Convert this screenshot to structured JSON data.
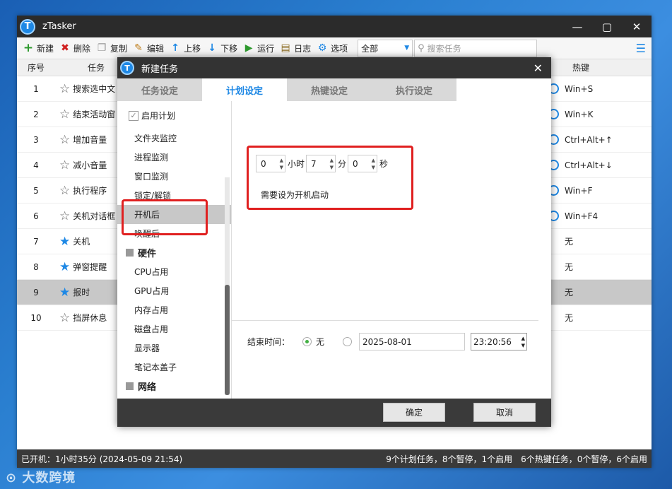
{
  "app": {
    "title": "zTasker",
    "logo": "T"
  },
  "toolbar": {
    "new": "新建",
    "delete": "删除",
    "copy": "复制",
    "edit": "编辑",
    "up": "上移",
    "down": "下移",
    "run": "运行",
    "log": "日志",
    "options": "选项",
    "filter": "全部",
    "search_placeholder": "搜索任务"
  },
  "table": {
    "col_no": "序号",
    "col_task": "任务",
    "col_hotkey": "热键",
    "rows": [
      {
        "no": "1",
        "task": "搜索选中文",
        "hotkey": "Win+S",
        "radio": true,
        "starred": false
      },
      {
        "no": "2",
        "task": "结束活动窗",
        "hotkey": "Win+K",
        "radio": true,
        "starred": false
      },
      {
        "no": "3",
        "task": "增加音量",
        "hotkey": "Ctrl+Alt+↑",
        "radio": true,
        "starred": false
      },
      {
        "no": "4",
        "task": "减小音量",
        "hotkey": "Ctrl+Alt+↓",
        "radio": true,
        "starred": false
      },
      {
        "no": "5",
        "task": "执行程序",
        "hotkey": "Win+F",
        "radio": true,
        "starred": false
      },
      {
        "no": "6",
        "task": "关机对话框",
        "hotkey": "Win+F4",
        "radio": true,
        "starred": false
      },
      {
        "no": "7",
        "task": "关机",
        "hotkey": "无",
        "radio": false,
        "starred": true
      },
      {
        "no": "8",
        "task": "弹窗提醒",
        "hotkey": "无",
        "radio": false,
        "starred": true
      },
      {
        "no": "9",
        "task": "报时",
        "hotkey": "无",
        "radio": false,
        "starred": true
      },
      {
        "no": "10",
        "task": "挡屏休息",
        "hotkey": "无",
        "radio": false,
        "starred": false
      }
    ]
  },
  "status": {
    "left": "已开机：1小时35分 (2024-05-09 21:54)",
    "right": "9个计划任务，8个暂停，1个启用　6个热键任务，0个暂停，6个启用"
  },
  "dialog": {
    "title": "新建任务",
    "tabs": [
      "任务设定",
      "计划设定",
      "热键设定",
      "执行设定"
    ],
    "enable_plan": "启用计划",
    "menu": [
      "文件夹监控",
      "进程监测",
      "窗口监测",
      "锁定/解锁",
      "开机后",
      "唤醒后"
    ],
    "hardware_group": "硬件",
    "hardware_items": [
      "CPU占用",
      "GPU占用",
      "内存占用",
      "磁盘占用",
      "显示器",
      "笔记本盖子"
    ],
    "network_group": "网络",
    "hours": "0",
    "hours_unit": "小时",
    "minutes": "7",
    "minutes_unit": "分",
    "seconds": "0",
    "seconds_unit": "秒",
    "note": "需要设为开机启动",
    "end_label": "结束时间：",
    "end_none": "无",
    "end_date": "2025-08-01",
    "end_time": "23:20:56",
    "ok": "确定",
    "cancel": "取消"
  },
  "watermark": "大数跨境",
  "colors": {
    "accent": "#1e88e5",
    "highlight": "#e02020"
  }
}
